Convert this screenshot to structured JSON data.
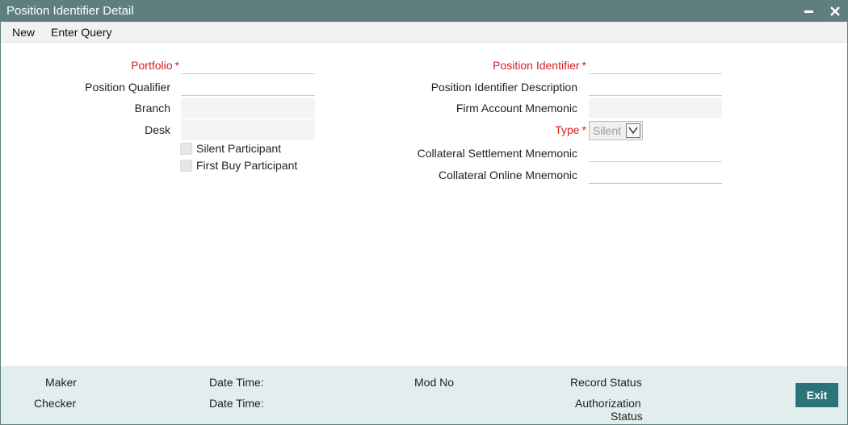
{
  "window": {
    "title": "Position Identifier Detail"
  },
  "menu": {
    "new_label": "New",
    "enter_query_label": "Enter Query"
  },
  "form": {
    "required_mark": "*",
    "portfolio_label": "Portfolio",
    "portfolio_value": "",
    "position_qualifier_label": "Position Qualifier",
    "position_qualifier_value": "",
    "branch_label": "Branch",
    "branch_value": "",
    "desk_label": "Desk",
    "desk_value": "",
    "silent_participant_label": "Silent Participant",
    "silent_participant_checked": false,
    "first_buy_participant_label": "First Buy Participant",
    "first_buy_participant_checked": false,
    "position_identifier_label": "Position Identifier",
    "position_identifier_value": "",
    "position_identifier_description_label": "Position Identifier Description",
    "position_identifier_description_value": "",
    "firm_account_mnemonic_label": "Firm Account Mnemonic",
    "firm_account_mnemonic_value": "",
    "type_label": "Type",
    "type_value": "Silent",
    "collateral_settlement_mnemonic_label": "Collateral Settlement Mnemonic",
    "collateral_settlement_mnemonic_value": "",
    "collateral_online_mnemonic_label": "Collateral Online Mnemonic",
    "collateral_online_mnemonic_value": ""
  },
  "footer": {
    "maker_label": "Maker",
    "checker_label": "Checker",
    "maker_date_time_label": "Date Time:",
    "checker_date_time_label": "Date Time:",
    "mod_no_label": "Mod No",
    "record_status_label": "Record Status",
    "authorization_status_label_1": "Authorization",
    "authorization_status_label_2": "Status",
    "exit_label": "Exit"
  },
  "colors": {
    "titlebar": "#5f7f7f",
    "required": "#d62020",
    "footer_bg": "#e2eeee",
    "exit_button": "#2a7379"
  },
  "icons": {
    "minimize": "minimize-icon",
    "close": "close-icon",
    "dropdown": "chevron-down-icon"
  }
}
